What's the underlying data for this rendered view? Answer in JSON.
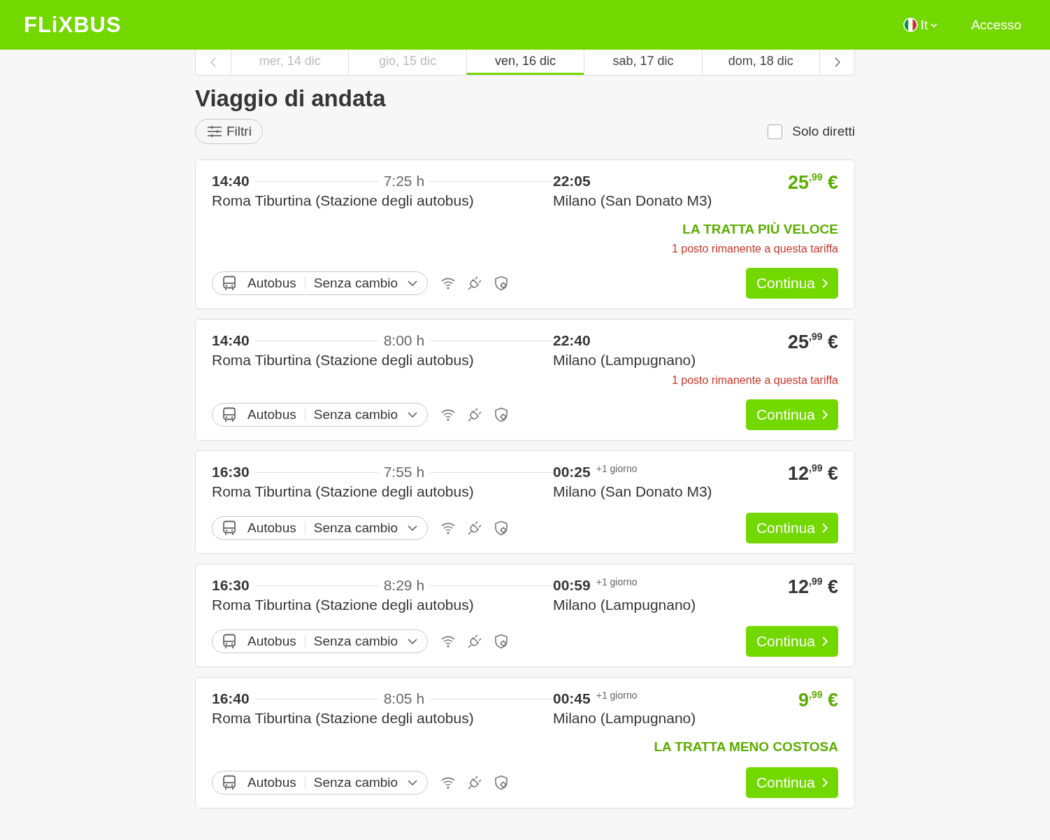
{
  "header": {
    "logo": "FLiXBUS",
    "language": "It",
    "login": "Accesso"
  },
  "date_tabs": [
    {
      "label": "mer, 14 dic",
      "selected": false,
      "disabled": true
    },
    {
      "label": "gio, 15 dic",
      "selected": false,
      "disabled": true
    },
    {
      "label": "ven, 16 dic",
      "selected": true,
      "disabled": false
    },
    {
      "label": "sab, 17 dic",
      "selected": false,
      "disabled": false
    },
    {
      "label": "dom, 18 dic",
      "selected": false,
      "disabled": false
    }
  ],
  "title": "Viaggio di andata",
  "filters_button": "Filtri",
  "direct_only": {
    "label": "Solo diretti",
    "checked": false
  },
  "trips": [
    {
      "departure_time": "14:40",
      "duration": "7:25 h",
      "departure_station": "Roma Tiburtina (Stazione degli autobus)",
      "arrival_time": "22:05",
      "arrival_station": "Milano (San Donato M3)",
      "price": "25",
      "cents": ",99",
      "currency": "€",
      "price_highlighted": true,
      "badge": "LA TRATTA PIÙ VELOCE",
      "seats_note": "1 posto rimanente a questa tariffa",
      "vehicle": "Autobus",
      "transfers": "Senza cambio",
      "button": "Continua"
    },
    {
      "departure_time": "14:40",
      "duration": "8:00 h",
      "departure_station": "Roma Tiburtina (Stazione degli autobus)",
      "arrival_time": "22:40",
      "arrival_station": "Milano (Lampugnano)",
      "price": "25",
      "cents": ",99",
      "currency": "€",
      "price_highlighted": false,
      "seats_note": "1 posto rimanente a questa tariffa",
      "vehicle": "Autobus",
      "transfers": "Senza cambio",
      "button": "Continua"
    },
    {
      "departure_time": "16:30",
      "duration": "7:55 h",
      "departure_station": "Roma Tiburtina (Stazione degli autobus)",
      "arrival_time": "00:25",
      "next_day": "+1 giorno",
      "arrival_station": "Milano (San Donato M3)",
      "price": "12",
      "cents": ",99",
      "currency": "€",
      "price_highlighted": false,
      "vehicle": "Autobus",
      "transfers": "Senza cambio",
      "button": "Continua"
    },
    {
      "departure_time": "16:30",
      "duration": "8:29 h",
      "departure_station": "Roma Tiburtina (Stazione degli autobus)",
      "arrival_time": "00:59",
      "next_day": "+1 giorno",
      "arrival_station": "Milano (Lampugnano)",
      "price": "12",
      "cents": ",99",
      "currency": "€",
      "price_highlighted": false,
      "vehicle": "Autobus",
      "transfers": "Senza cambio",
      "button": "Continua"
    },
    {
      "departure_time": "16:40",
      "duration": "8:05 h",
      "departure_station": "Roma Tiburtina (Stazione degli autobus)",
      "arrival_time": "00:45",
      "next_day": "+1 giorno",
      "arrival_station": "Milano (Lampugnano)",
      "price": "9",
      "cents": ",99",
      "currency": "€",
      "price_highlighted": true,
      "badge": "LA TRATTA MENO COSTOSA",
      "vehicle": "Autobus",
      "transfers": "Senza cambio",
      "button": "Continua"
    }
  ]
}
